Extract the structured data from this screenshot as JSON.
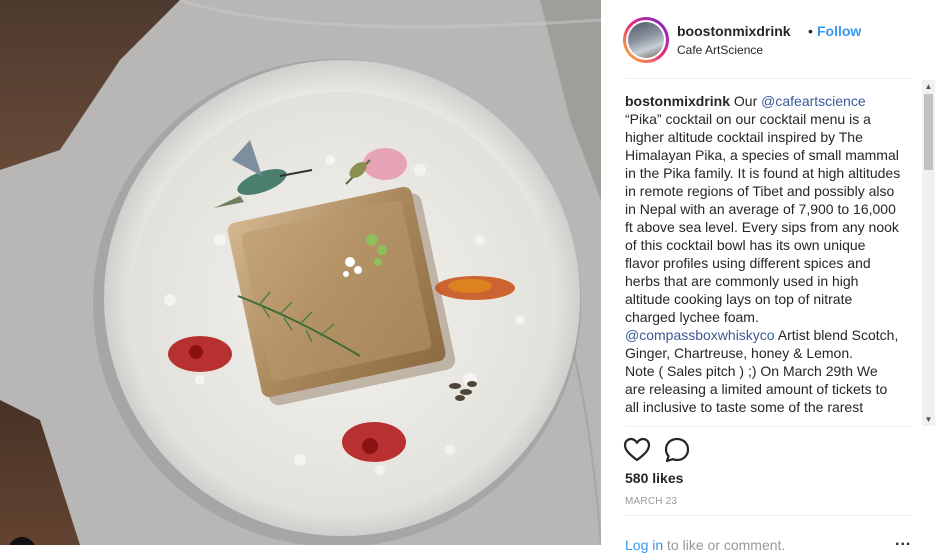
{
  "post": {
    "username": "boostonmixdrink",
    "follow_label": "Follow",
    "separator": "•",
    "location": "Cafe ArtScience"
  },
  "caption": {
    "username": "bostonmixdrink",
    "text_1": " Our ",
    "mention_1": "@cafeartscience",
    "text_2": "\n“Pika” cocktail on our cocktail menu is a higher altitude cocktail inspired by The Himalayan Pika, a species of small mammal in the Pika family. It is found at high altitudes in remote regions of Tibet and possibly also in Nepal with an average of 7,900 to 16,000 ft above sea level. Every sips from any nook of this cocktail bowl has its own unique flavor profiles using different spices and herbs that are commonly used in high altitude cooking lays on top of nitrate charged lychee foam.\n",
    "mention_2": "@compassboxwhiskyco",
    "text_3": " Artist blend Scotch, Ginger, Chartreuse, honey & Lemon.\nNote ( Sales pitch ) ;) On March 29th We are releasing a limited amount of tickets to all inclusive to taste some of the rarest"
  },
  "icons": {
    "like": "heart-icon",
    "comment": "comment-icon",
    "scroll_up": "▲",
    "scroll_down": "▼"
  },
  "stats": {
    "likes": "580 likes",
    "date": "MARCH 23"
  },
  "footer": {
    "login_link": "Log in",
    "login_rest": " to like or comment.",
    "more": "..."
  },
  "colors": {
    "link_blue": "#3897f0",
    "mention_blue": "#3b5998",
    "muted": "#999999"
  }
}
